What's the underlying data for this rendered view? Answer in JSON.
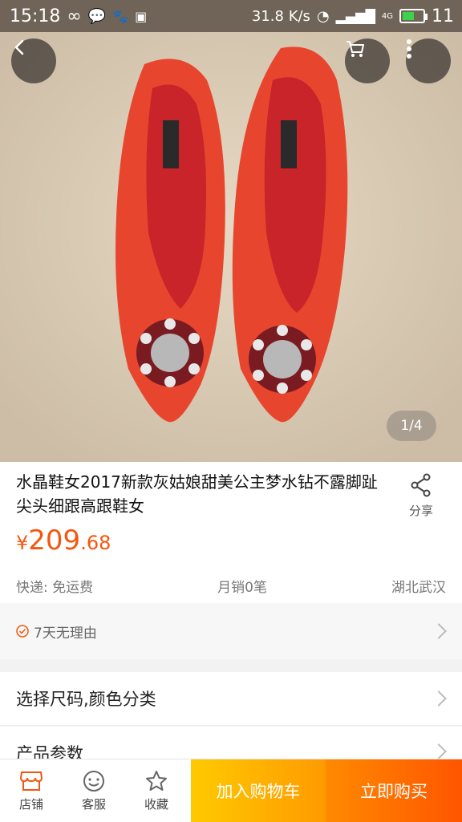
{
  "status_bar": {
    "time": "15:18",
    "speed": "31.8 K/s",
    "battery": "11",
    "network": "4G"
  },
  "gallery": {
    "counter": "1/4"
  },
  "product": {
    "title": "水晶鞋女2017新款灰姑娘甜美公主梦水钻不露脚趾尖头细跟高跟鞋女",
    "price_symbol": "¥",
    "price_int": "209",
    "price_dec": ".68",
    "shipping": "快递: 免运费",
    "monthly_sales": "月销0笔",
    "location": "湖北武汉",
    "share_label": "分享"
  },
  "guarantee": {
    "label": "7天无理由"
  },
  "options": {
    "size_color": "选择尺码,颜色分类",
    "params": "产品参数"
  },
  "bottom_bar": {
    "shop": "店铺",
    "service": "客服",
    "favorite": "收藏",
    "add_to_cart": "加入购物车",
    "buy_now": "立即购买"
  },
  "colors": {
    "accent": "#f5560f",
    "cart_button": "#ffb000",
    "buy_button": "#ff6a00"
  }
}
